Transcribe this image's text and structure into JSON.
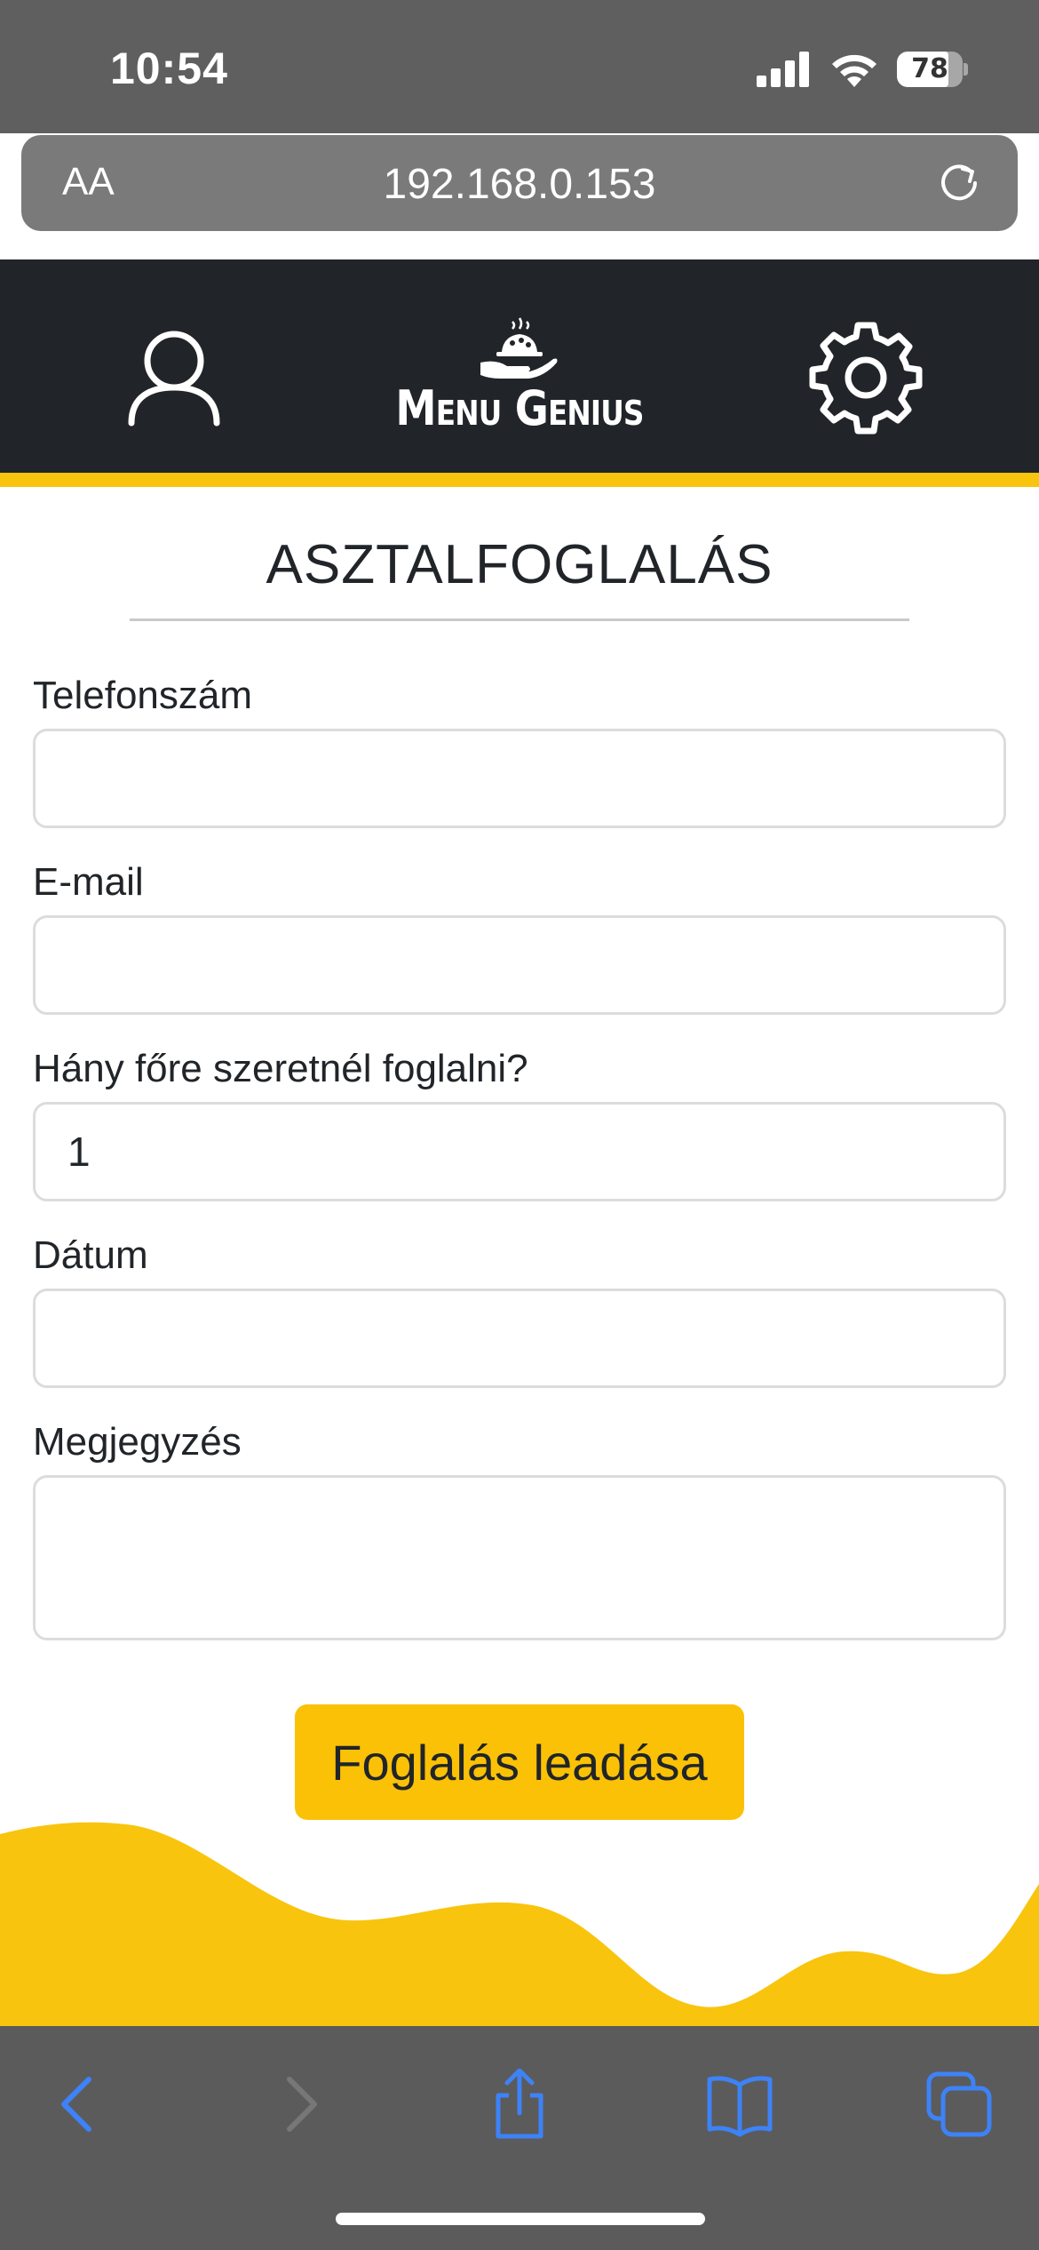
{
  "status_bar": {
    "time": "10:54",
    "battery": "78"
  },
  "url_bar": {
    "aa": "AA",
    "url": "192.168.0.153"
  },
  "header": {
    "logo_text": "Menu Genius"
  },
  "form": {
    "title": "ASZTALFOGLALÁS",
    "fields": [
      {
        "label": "Telefonszám",
        "value": ""
      },
      {
        "label": "E-mail",
        "value": ""
      },
      {
        "label": "Hány főre szeretnél foglalni?",
        "value": "1"
      },
      {
        "label": "Dátum",
        "value": ""
      },
      {
        "label": "Megjegyzés",
        "value": ""
      }
    ],
    "submit_label": "Foglalás leadása"
  },
  "colors": {
    "accent": "#fbc107",
    "header_bg": "#212429",
    "browser_chrome": "#5b5b5b",
    "ios_blue": "#3e82f7"
  },
  "icons": [
    "signal-icon",
    "wifi-icon",
    "battery-icon",
    "reload-icon",
    "user-icon",
    "logo-food-icon",
    "gear-icon",
    "back-icon",
    "forward-icon",
    "share-icon",
    "bookmarks-icon",
    "tabs-icon"
  ]
}
